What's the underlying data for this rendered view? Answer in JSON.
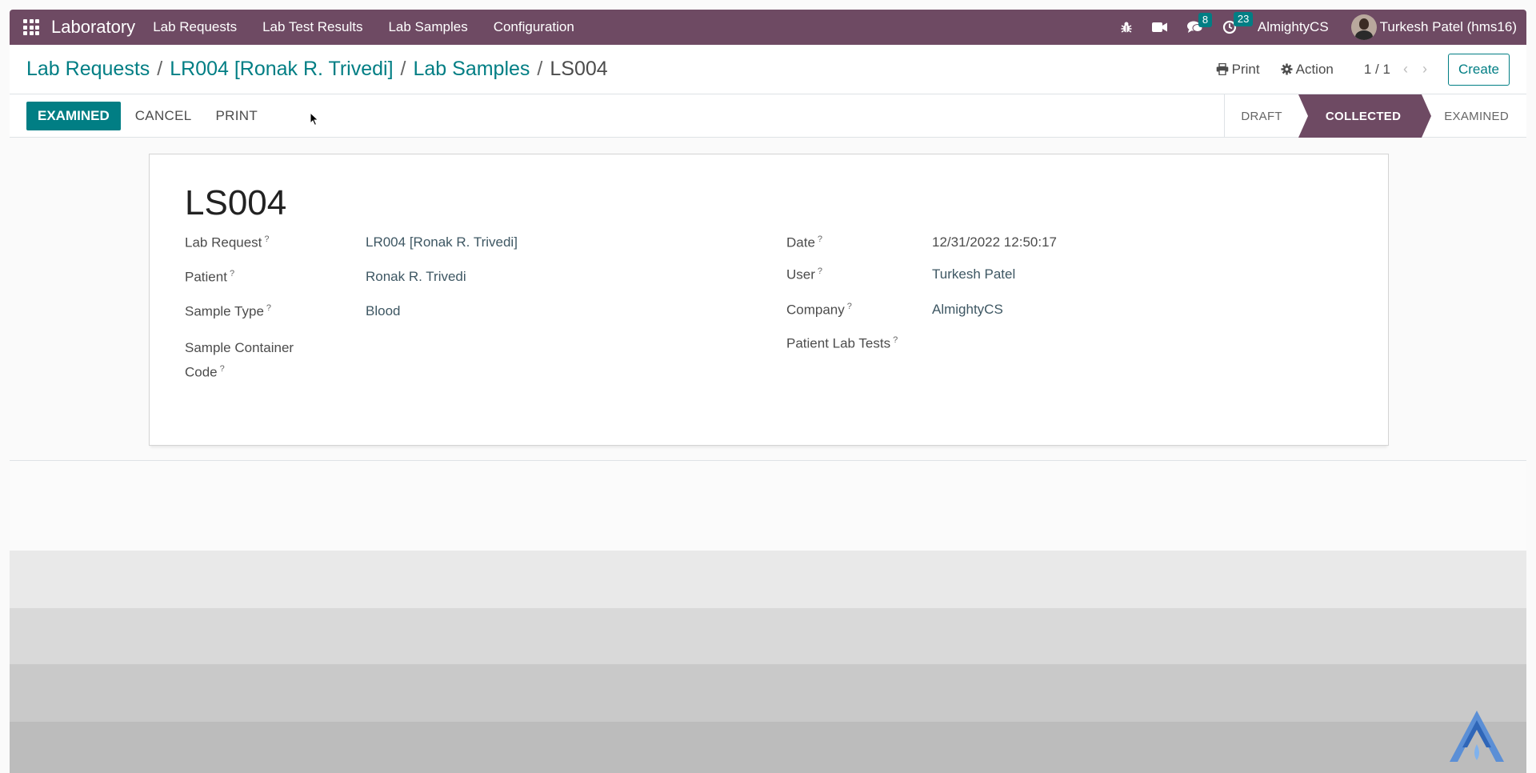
{
  "navbar": {
    "app_name": "Laboratory",
    "menu": [
      "Lab Requests",
      "Lab Test Results",
      "Lab Samples",
      "Configuration"
    ],
    "messages_count": "8",
    "activities_count": "23",
    "company": "AlmightyCS",
    "user": "Turkesh Patel (hms16)"
  },
  "breadcrumb": {
    "items": [
      "Lab Requests",
      "LR004 [Ronak R. Trivedi]",
      "Lab Samples"
    ],
    "separator": "/",
    "current": "LS004"
  },
  "control": {
    "print_label": "Print",
    "action_label": "Action",
    "pager": "1 / 1",
    "prev_icon": "chevron-left-icon",
    "next_icon": "chevron-right-icon",
    "create_label": "Create"
  },
  "statusbar": {
    "primary_button": "EXAMINED",
    "cancel_button": "CANCEL",
    "print_button": "PRINT",
    "stages": [
      "DRAFT",
      "COLLECTED",
      "EXAMINED"
    ],
    "active_stage": "COLLECTED"
  },
  "record": {
    "title": "LS004",
    "help_mark": "?",
    "left_fields": [
      {
        "label": "Lab Request",
        "value": "LR004 [Ronak R. Trivedi]"
      },
      {
        "label": "Patient",
        "value": "Ronak R. Trivedi"
      },
      {
        "label": "Sample Type",
        "value": "Blood"
      },
      {
        "label_line1": "Sample Container",
        "label_line2": "Code",
        "value": ""
      }
    ],
    "right_fields": [
      {
        "label": "Date",
        "value": "12/31/2022 12:50:17"
      },
      {
        "label": "User",
        "value": "Turkesh Patel"
      },
      {
        "label": "Company",
        "value": "AlmightyCS"
      },
      {
        "label": "Patient Lab Tests",
        "value": ""
      }
    ]
  },
  "colors": {
    "navbar": "#6e4a63",
    "accent": "#017e84",
    "active_stage": "#6e4a63"
  }
}
